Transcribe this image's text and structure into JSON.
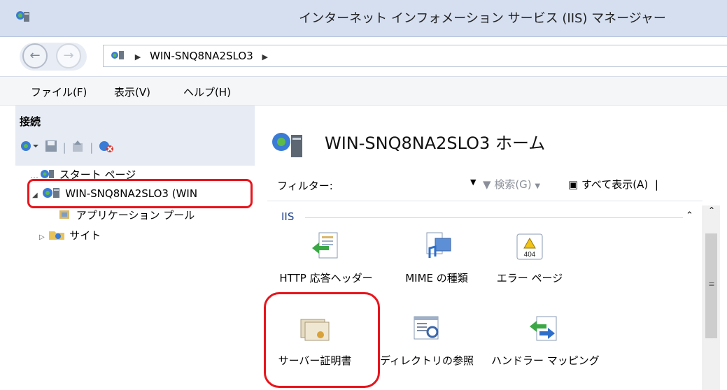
{
  "window": {
    "title": "インターネット インフォメーション サービス (IIS) マネージャー"
  },
  "address": {
    "path": [
      "WIN-SNQ8NA2SLO3"
    ]
  },
  "menu": {
    "file": "ファイル(F)",
    "view": "表示(V)",
    "help": "ヘルプ(H)"
  },
  "connections": {
    "header": "接続",
    "tree": {
      "start_page": "スタート ページ",
      "server": "WIN-SNQ8NA2SLO3 (WIN",
      "app_pools": "アプリケーション プール",
      "sites": "サイト"
    }
  },
  "main": {
    "title": "WIN-SNQ8NA2SLO3 ホーム",
    "filter": {
      "label": "フィルター:",
      "value": "",
      "search": "検索(G)",
      "show_all": "すべて表示(A)"
    },
    "group": "IIS",
    "features": {
      "http_headers": "HTTP 応答ヘッダー",
      "mime_types": "MIME の種類",
      "error_pages": "エラー ページ",
      "server_certs": "サーバー証明書",
      "dir_browsing": "ディレクトリの参照",
      "handler_mappings": "ハンドラー マッピング"
    },
    "error_icon_text": "404"
  },
  "colors": {
    "highlight": "#e8141c",
    "titlebar": "#d5dff0",
    "group_text": "#1e3f88"
  }
}
